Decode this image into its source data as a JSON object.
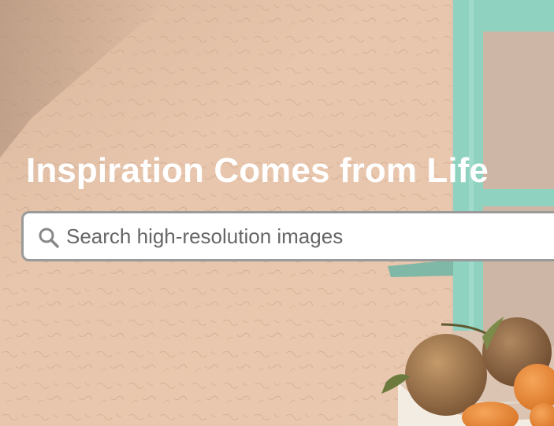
{
  "hero": {
    "headline": "Inspiration Comes from Life",
    "background_icon": "wall-photo-with-fruit-bowl"
  },
  "search": {
    "placeholder": "Search high-resolution images",
    "value": "",
    "icon": "search-icon"
  },
  "colors": {
    "wall": "#e6c4aa",
    "window_frame": "#8fd2c0",
    "headline_text": "#ffffff",
    "search_border": "#9a9a9a",
    "placeholder_text": "#666666"
  }
}
